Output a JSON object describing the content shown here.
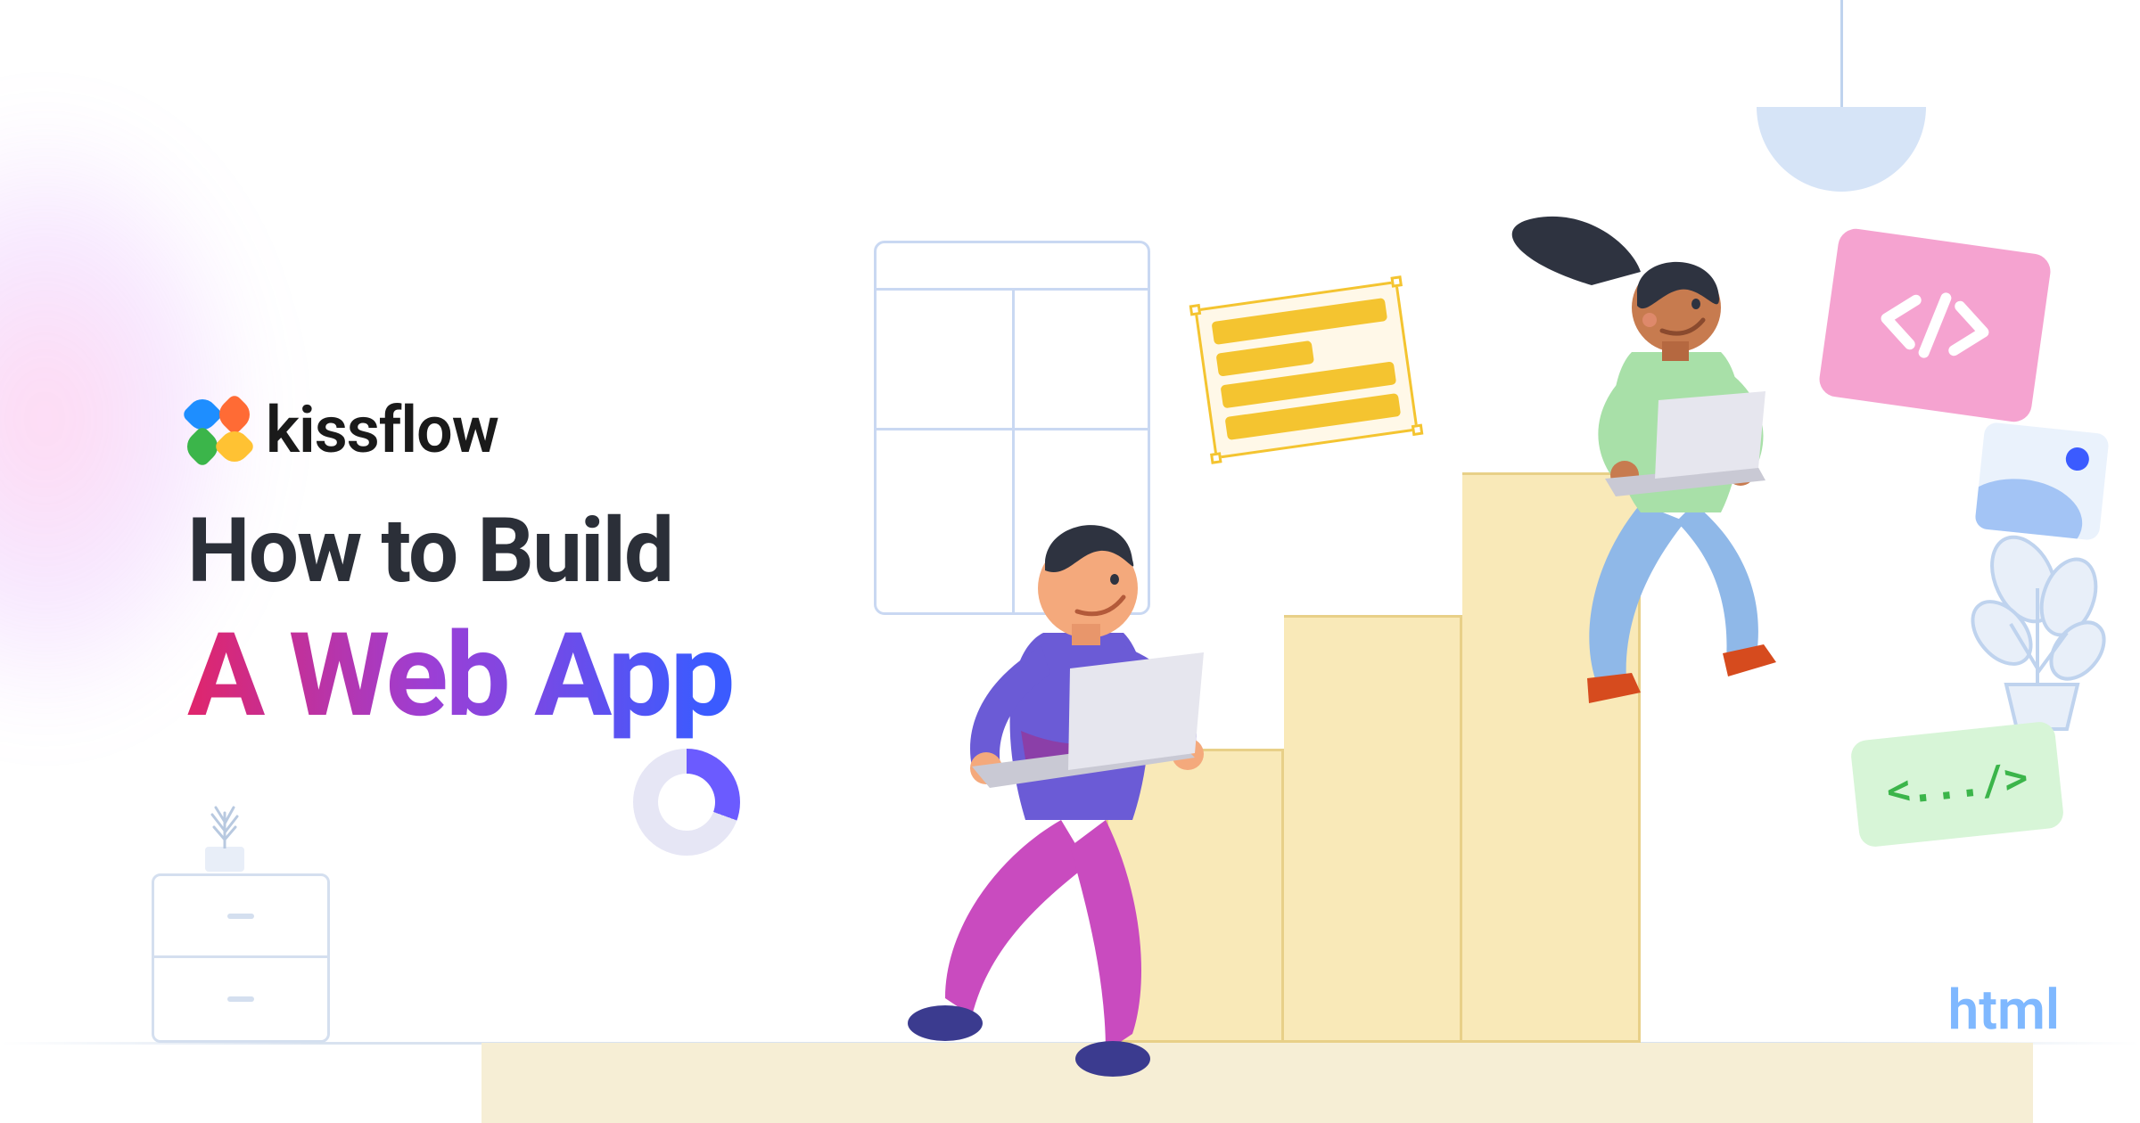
{
  "brand": {
    "name": "kissflow"
  },
  "headline": {
    "line1": "How to Build",
    "line2": "A Web App"
  },
  "labels": {
    "html": "html",
    "self_close_tag": "<.../>"
  },
  "colors": {
    "gradient_start": "#E0256B",
    "gradient_mid": "#9B3FD6",
    "gradient_end": "#3B5BFF",
    "accent_yellow": "#F4C430",
    "accent_green": "#3BB54A",
    "accent_pink": "#F5A3D0"
  }
}
